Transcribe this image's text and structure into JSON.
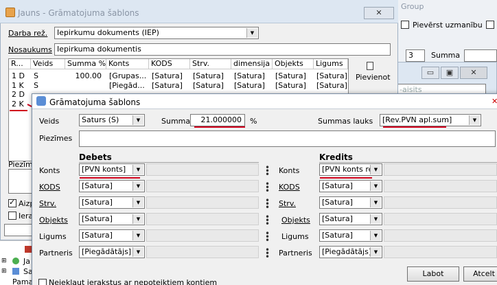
{
  "bg_window": {
    "title": "Jauns - Grāmatojuma šablons",
    "close": "✕",
    "darba_rez_label": "Darba rež.",
    "darba_rez_value": "Iepirkumu dokuments (IEP)",
    "nosaukums_label": "Nosaukums",
    "nosaukums_value": "Iepirkuma dokumentis",
    "columns": [
      "R...",
      "Veids",
      "Summa %",
      "Konts",
      "KODS",
      "Strv.",
      "dimensija",
      "Objekts",
      "Ligums"
    ],
    "rows": [
      [
        "1 D",
        "S",
        "100.00",
        "[Grupas...",
        "[Satura]",
        "[Satura]",
        "[Satura]",
        "[Satura]",
        "[Satura]"
      ],
      [
        "1 K",
        "S",
        "",
        "[Piegād...",
        "[Satura]",
        "[Satura]",
        "[Satura]",
        "[Satura]",
        "[Satura]"
      ],
      [
        "2 D",
        "",
        "",
        "",
        "",
        "",
        "",
        "",
        ""
      ],
      [
        "2 K",
        "",
        "",
        "",
        "",
        "",
        "",
        "",
        ""
      ]
    ],
    "pievienot": "Pievienot",
    "piezimes_label": "Piezīme",
    "aizp_label": "Aizp",
    "iera_label": "Iera",
    "bottom_check_label": "Neieklaut ierakstus ar nepoteiktiem kontiem"
  },
  "right_bg": {
    "group_label": "Group",
    "piesaistit_label": "Pievērst uzmanību",
    "summa_label": "Summa",
    "small_value": "3",
    "search_placeholder": "-aisits",
    "win_buttons": [
      "▭",
      "▣",
      "✕"
    ]
  },
  "tree_items": [
    "Ja",
    "Sa",
    "Pamat"
  ],
  "dialog": {
    "title": "Grāmatojuma šablons",
    "close": "✕",
    "veids_label": "Veids",
    "veids_value": "Saturs (S)",
    "summa_label": "Summa",
    "summa_value": "21.000000",
    "percent": "%",
    "summas_lauks_label": "Summas lauks",
    "summas_lauks_value": "[Rev.PVN apl.sum]",
    "piezimes_label": "Piezīmes",
    "debets_title": "Debets",
    "kredits_title": "Kredits",
    "debets": [
      {
        "label": "Konts",
        "value": "[PVN konts]"
      },
      {
        "label": "KODS",
        "value": "[Satura]"
      },
      {
        "label": "Strv.",
        "value": "[Satura]"
      },
      {
        "label": "Objekts",
        "value": "[Satura]"
      },
      {
        "label": "Ligums",
        "value": "[Satura]"
      },
      {
        "label": "Partneris",
        "value": "[Piegādātājs]"
      }
    ],
    "kredits": [
      {
        "label": "Konts",
        "value": "[PVN konts rea"
      },
      {
        "label": "KODS",
        "value": "[Satura]"
      },
      {
        "label": "Strv.",
        "value": "[Satura]"
      },
      {
        "label": "Objekts",
        "value": "[Satura]"
      },
      {
        "label": "Ligums",
        "value": "[Satura]"
      },
      {
        "label": "Partneris",
        "value": "[Piegādātājs]"
      }
    ],
    "labot": "Labot",
    "atcelt": "Atcelt"
  },
  "colors": {
    "accent_red": "#d0021b"
  }
}
